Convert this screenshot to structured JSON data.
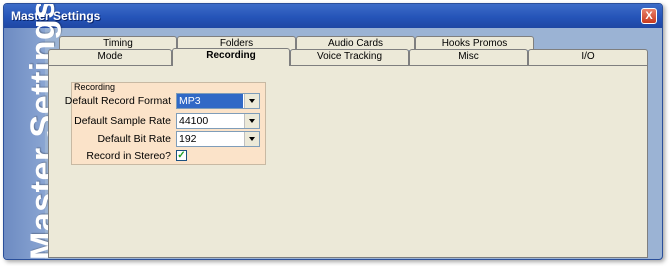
{
  "window": {
    "title": "Master Settings",
    "close_label": "X"
  },
  "side_banner": {
    "label": "Master Settings"
  },
  "tabs": {
    "back_row": [
      "Timing",
      "Folders",
      "Audio Cards",
      "Hooks Promos"
    ],
    "front_row": [
      "Mode",
      "Recording",
      "Voice Tracking",
      "Misc",
      "I/O"
    ],
    "active": "Recording"
  },
  "recording": {
    "group_title": "Recording",
    "format_label": "Default Record Format",
    "format_value": "MP3",
    "sample_rate_label": "Default Sample Rate",
    "sample_rate_value": "44100",
    "bit_rate_label": "Default Bit Rate",
    "bit_rate_value": "192",
    "stereo_label": "Record in Stereo?",
    "stereo_checked": "✓"
  },
  "colors": {
    "titlebar": "#2554b8",
    "window_frame": "#9bb3d4",
    "panel": "#ece9d8",
    "group_bg": "#fbe3c9",
    "selection": "#3169c6"
  },
  "icons": {
    "close": "close-icon",
    "dropdown": "chevron-down-icon",
    "checkbox": "checkmark-icon"
  }
}
